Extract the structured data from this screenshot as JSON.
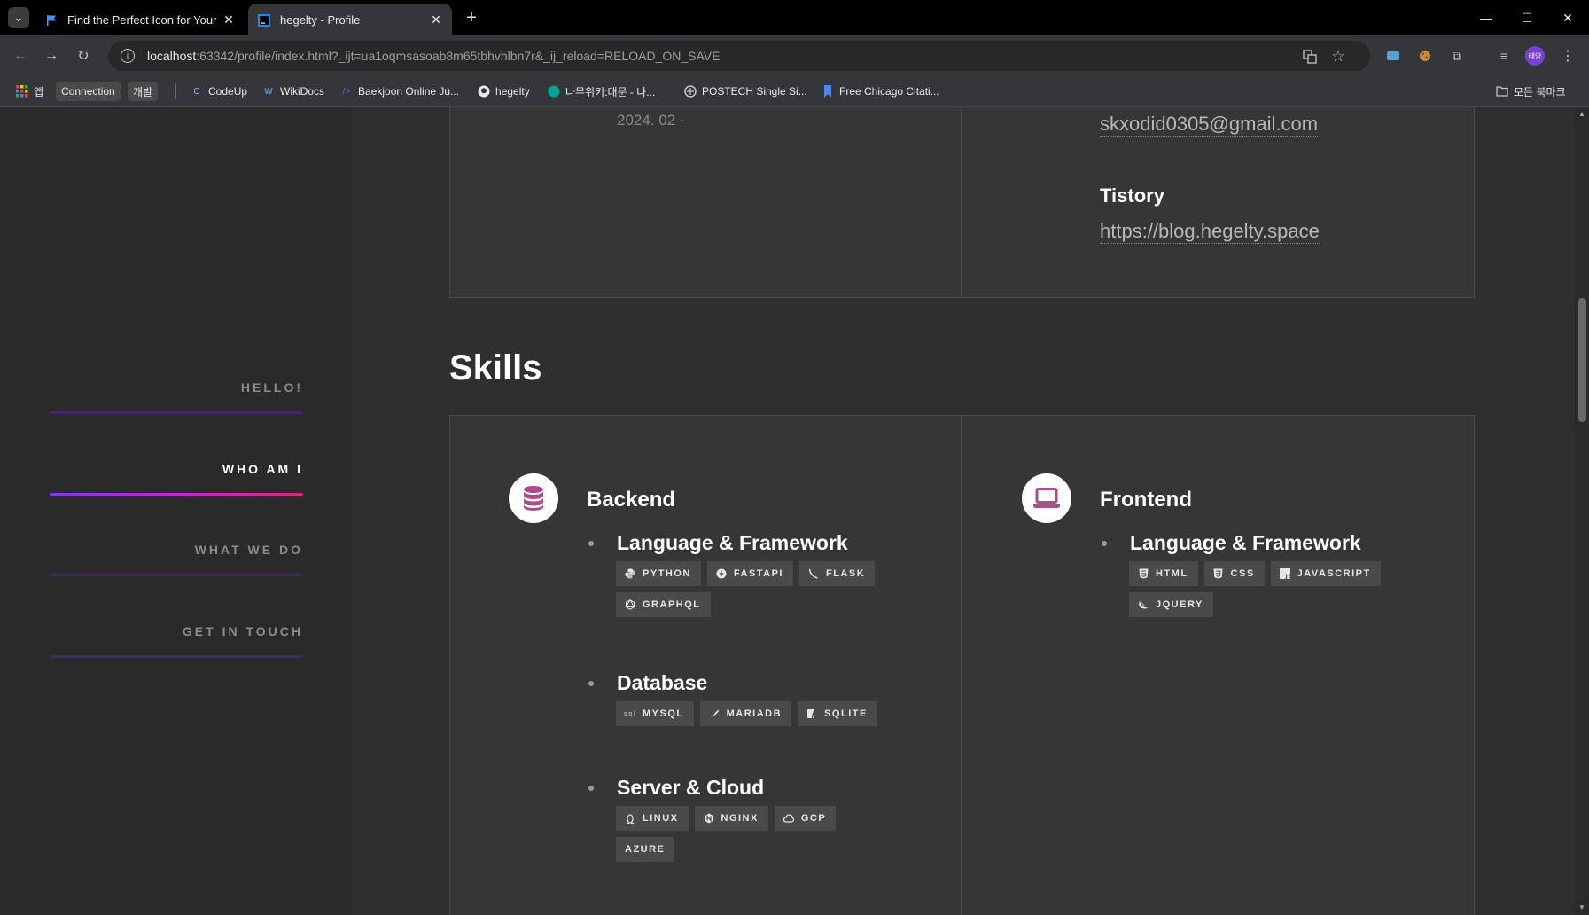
{
  "browser": {
    "tabs": [
      {
        "title": "Find the Perfect Icon for Your",
        "active": false
      },
      {
        "title": "hegelty - Profile",
        "active": true
      }
    ],
    "url_host": "localhost",
    "url_rest": ":63342/profile/index.html?_ijt=ua1oqmsasoab8m65tbhvhlbn7r&_ij_reload=RELOAD_ON_SAVE",
    "avatar_label": "태양",
    "bookmarks": [
      {
        "label": "앱",
        "icon": "apps-grid-icon"
      },
      {
        "label": "Connection",
        "icon": "",
        "chip": true
      },
      {
        "label": "개발",
        "icon": "",
        "chip": true
      },
      {
        "label": "CodeUp",
        "icon": "codeup-icon"
      },
      {
        "label": "WikiDocs",
        "icon": "wikidocs-icon"
      },
      {
        "label": "Baekjoon Online Ju...",
        "icon": "baekjoon-icon"
      },
      {
        "label": "hegelty",
        "icon": "github-icon"
      },
      {
        "label": "나무위키:대문 - 나...",
        "icon": "namuwiki-icon"
      },
      {
        "label": "POSTECH Single Si...",
        "icon": "postech-icon"
      },
      {
        "label": "Free Chicago Citati...",
        "icon": "bookmark-icon"
      }
    ],
    "all_bookmarks": "모든 북마크"
  },
  "sidebar": {
    "items": [
      {
        "label": "HELLO!",
        "active": false
      },
      {
        "label": "WHO AM I",
        "active": true
      },
      {
        "label": "WHAT WE DO",
        "active": false
      },
      {
        "label": "GET IN TOUCH",
        "active": false
      }
    ]
  },
  "contact": {
    "date": "2024. 02 -",
    "email": "skxodid0305@gmail.com",
    "tistory_title": "Tistory",
    "tistory_url": "https://blog.hegelty.space"
  },
  "skills": {
    "title": "Skills",
    "backend": {
      "title": "Backend",
      "groups": [
        {
          "title": "Language & Framework",
          "badges": [
            {
              "label": "PYTHON",
              "icon": "python-icon"
            },
            {
              "label": "FASTAPI",
              "icon": "fastapi-icon"
            },
            {
              "label": "FLASK",
              "icon": "flask-icon"
            },
            {
              "label": "GRAPHQL",
              "icon": "graphql-icon"
            }
          ]
        },
        {
          "title": "Database",
          "badges": [
            {
              "label": "MYSQL",
              "icon": "mysql-icon"
            },
            {
              "label": "MARIADB",
              "icon": "mariadb-icon"
            },
            {
              "label": "SQLITE",
              "icon": "sqlite-icon"
            }
          ]
        },
        {
          "title": "Server & Cloud",
          "badges": [
            {
              "label": "LINUX",
              "icon": "linux-icon"
            },
            {
              "label": "NGINX",
              "icon": "nginx-icon"
            },
            {
              "label": "GCP",
              "icon": "gcp-icon"
            },
            {
              "label": "AZURE",
              "icon": ""
            }
          ]
        }
      ]
    },
    "frontend": {
      "title": "Frontend",
      "groups": [
        {
          "title": "Language & Framework",
          "badges": [
            {
              "label": "HTML",
              "icon": "html5-icon"
            },
            {
              "label": "CSS",
              "icon": "css3-icon"
            },
            {
              "label": "JAVASCRIPT",
              "icon": "javascript-icon"
            },
            {
              "label": "JQUERY",
              "icon": "jquery-icon"
            }
          ]
        }
      ]
    }
  },
  "colors": {
    "accent": "#b04a8a",
    "gradient_start": "#7c3aed",
    "gradient_end": "#db2777"
  }
}
